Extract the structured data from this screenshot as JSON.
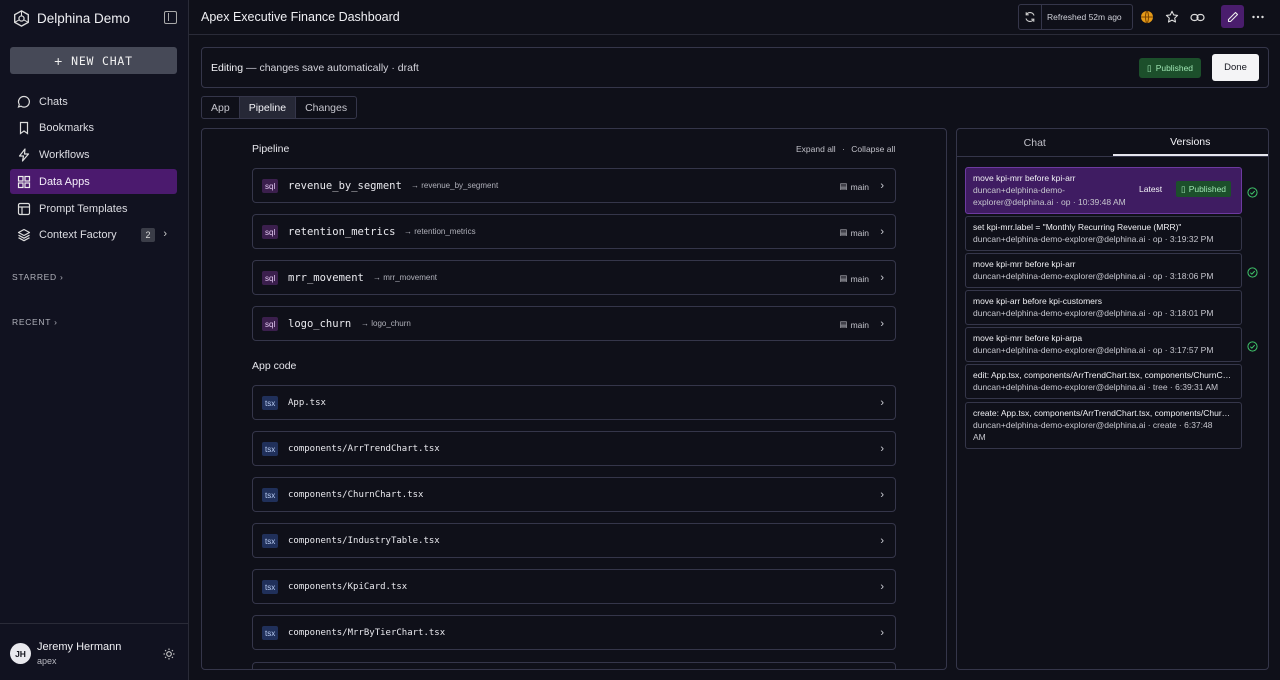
{
  "sidebar": {
    "brand": "Delphina Demo",
    "new_chat": "NEW CHAT",
    "nav": [
      {
        "label": "Chats",
        "icon": "chat-bubble-icon"
      },
      {
        "label": "Bookmarks",
        "icon": "bookmark-icon"
      },
      {
        "label": "Workflows",
        "icon": "workflow-icon"
      },
      {
        "label": "Data Apps",
        "icon": "grid-icon",
        "active": true
      },
      {
        "label": "Prompt Templates",
        "icon": "template-icon"
      },
      {
        "label": "Context Factory",
        "icon": "layers-icon",
        "badge": "2"
      }
    ],
    "starred": "STARRED",
    "recent": "RECENT",
    "user": {
      "initials": "JH",
      "name": "Jeremy Hermann",
      "org": "apex"
    }
  },
  "header": {
    "title": "Apex Executive Finance Dashboard",
    "refreshed": "Refreshed 52m ago"
  },
  "edit_bar": {
    "editing": "Editing",
    "status": " — changes save automatically · draft",
    "published": "Published",
    "done": "Done"
  },
  "tabs": [
    {
      "label": "App"
    },
    {
      "label": "Pipeline",
      "active": true
    },
    {
      "label": "Changes"
    }
  ],
  "pipeline": {
    "title": "Pipeline",
    "expand_all": "Expand all",
    "collapse_all": "Collapse all",
    "separator": "·",
    "items": [
      {
        "tag": "sql",
        "name": "revenue_by_segment",
        "output": "→ revenue_by_segment",
        "branch": "main"
      },
      {
        "tag": "sql",
        "name": "retention_metrics",
        "output": "→ retention_metrics",
        "branch": "main"
      },
      {
        "tag": "sql",
        "name": "mrr_movement",
        "output": "→ mrr_movement",
        "branch": "main"
      },
      {
        "tag": "sql",
        "name": "logo_churn",
        "output": "→ logo_churn",
        "branch": "main"
      }
    ]
  },
  "app_code": {
    "title": "App code",
    "items": [
      {
        "tag": "tsx",
        "name": "App.tsx"
      },
      {
        "tag": "tsx",
        "name": "components/ArrTrendChart.tsx"
      },
      {
        "tag": "tsx",
        "name": "components/ChurnChart.tsx"
      },
      {
        "tag": "tsx",
        "name": "components/IndustryTable.tsx"
      },
      {
        "tag": "tsx",
        "name": "components/KpiCard.tsx"
      },
      {
        "tag": "tsx",
        "name": "components/MrrByTierChart.tsx"
      }
    ]
  },
  "right_panel": {
    "tabs": [
      {
        "label": "Chat"
      },
      {
        "label": "Versions",
        "active": true
      }
    ],
    "latest": "Latest",
    "published": "Published",
    "versions": [
      {
        "title": "move kpi-mrr before kpi-arr",
        "meta1": "duncan+delphina-demo-",
        "meta2": "explorer@delphina.ai · op · 10:39:48 AM",
        "active": true,
        "check": true
      },
      {
        "title": "set kpi-mrr.label = \"Monthly Recurring Revenue (MRR)\"",
        "meta1": "duncan+delphina-demo-explorer@delphina.ai · op · 3:19:32 PM",
        "check": false
      },
      {
        "title": "move kpi-mrr before kpi-arr",
        "meta1": "duncan+delphina-demo-explorer@delphina.ai · op · 3:18:06 PM",
        "check": true
      },
      {
        "title": "move kpi-arr before kpi-customers",
        "meta1": "duncan+delphina-demo-explorer@delphina.ai · op · 3:18:01 PM",
        "check": false
      },
      {
        "title": "move kpi-mrr before kpi-arpa",
        "meta1": "duncan+delphina-demo-explorer@delphina.ai · op · 3:17:57 PM",
        "check": true
      },
      {
        "title": "edit: App.tsx, components/ArrTrendChart.tsx, components/ChurnChart.tsx",
        "meta1": "duncan+delphina-demo-explorer@delphina.ai · tree · 6:39:31 AM",
        "check": false
      },
      {
        "title": "create: App.tsx, components/ArrTrendChart.tsx, components/ChurnChart.tsx",
        "meta1": "duncan+delphina-demo-explorer@delphina.ai · create · 6:37:48",
        "meta2": "AM",
        "check": false
      }
    ]
  },
  "colors": {
    "accent": "#4b1a6e",
    "published_bg": "#1c4f2b",
    "published_fg": "#9fe6b3",
    "check": "#3fc46a"
  }
}
